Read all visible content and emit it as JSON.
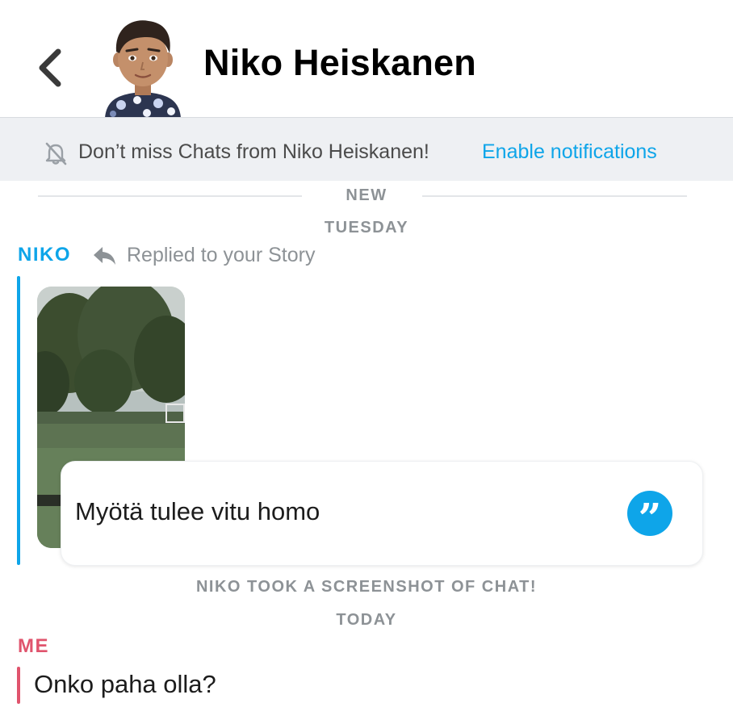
{
  "chat": {
    "title": "Niko Heiskanen"
  },
  "notification_banner": {
    "text": "Don’t miss Chats from Niko Heiskanen!",
    "link": "Enable notifications"
  },
  "separators": {
    "new": "NEW",
    "tuesday": "TUESDAY",
    "screenshot_notice": "NIKO TOOK A SCREENSHOT OF CHAT!",
    "today": "TODAY"
  },
  "messages": [
    {
      "sender": "NIKO",
      "context": "Replied to your Story",
      "text": "Myötä tulee vitu homo"
    },
    {
      "sender": "ME",
      "text": "Onko paha olla?"
    }
  ],
  "colors": {
    "accent_blue": "#0ea5e9",
    "me_red": "#e0546d",
    "banner_bg": "#eef0f3"
  },
  "icons": {
    "back": "chevron-left-icon",
    "notifications_off": "bell-off-icon",
    "reply": "reply-arrow-icon",
    "quote": "quote-icon"
  }
}
